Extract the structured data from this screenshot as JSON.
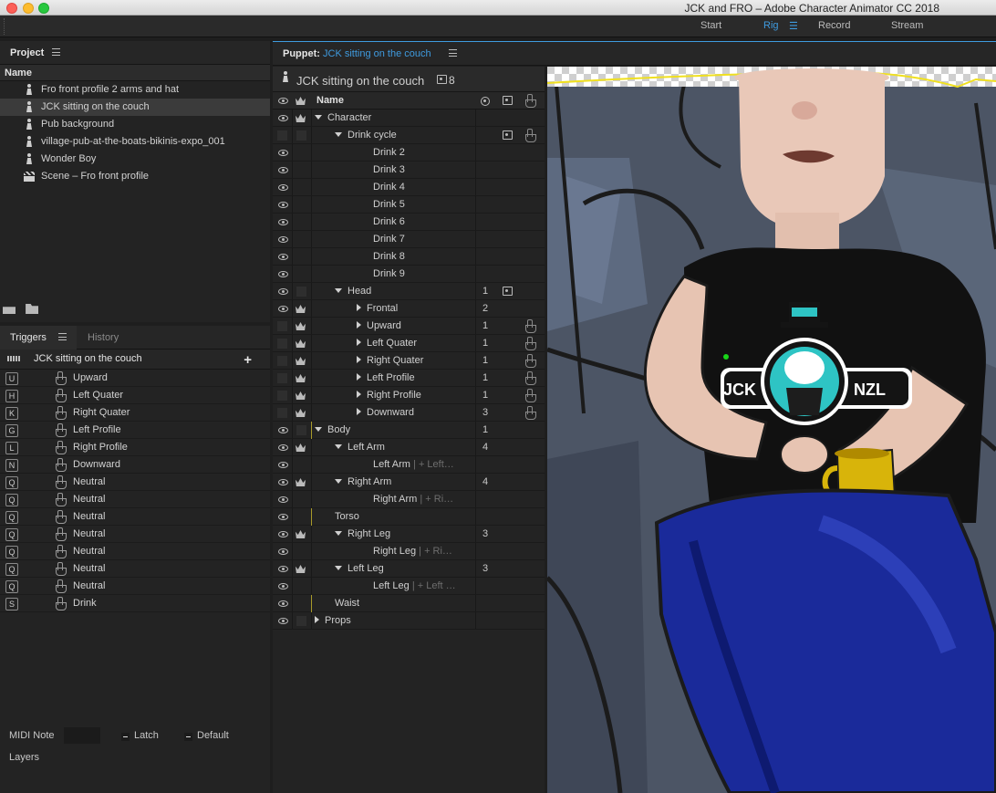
{
  "window": {
    "title": "JCK and FRO – Adobe Character Animator CC 2018"
  },
  "workspaces": [
    {
      "label": "Start",
      "active": false
    },
    {
      "label": "Rig",
      "active": true
    },
    {
      "label": "Record",
      "active": false
    },
    {
      "label": "Stream",
      "active": false
    }
  ],
  "project": {
    "title": "Project",
    "column_name": "Name",
    "items": [
      {
        "label": "Fro front profile 2 arms and hat",
        "icon": "puppet-icon"
      },
      {
        "label": "JCK sitting on the couch",
        "icon": "puppet-icon",
        "selected": true
      },
      {
        "label": "Pub background",
        "icon": "puppet-icon"
      },
      {
        "label": "village-pub-at-the-boats-bikinis-expo_001",
        "icon": "puppet-icon"
      },
      {
        "label": "Wonder Boy",
        "icon": "puppet-icon"
      },
      {
        "label": "Scene – Fro front profile",
        "icon": "scene-icon"
      }
    ]
  },
  "triggers": {
    "tab_triggers": "Triggers",
    "tab_history": "History",
    "puppet_name": "JCK sitting on the couch",
    "rows": [
      {
        "key": "U",
        "label": "Upward"
      },
      {
        "key": "H",
        "label": "Left Quater"
      },
      {
        "key": "K",
        "label": "Right Quater"
      },
      {
        "key": "G",
        "label": "Left Profile"
      },
      {
        "key": "L",
        "label": "Right  Profile"
      },
      {
        "key": "N",
        "label": "Downward"
      },
      {
        "key": "Q",
        "label": "Neutral"
      },
      {
        "key": "Q",
        "label": "Neutral"
      },
      {
        "key": "Q",
        "label": "Neutral"
      },
      {
        "key": "Q",
        "label": "Neutral"
      },
      {
        "key": "Q",
        "label": "Neutral"
      },
      {
        "key": "Q",
        "label": "Neutral"
      },
      {
        "key": "Q",
        "label": "Neutral"
      },
      {
        "key": "S",
        "label": "Drink"
      }
    ],
    "midi_note_label": "MIDI Note",
    "latch_label": "Latch",
    "default_label": "Default",
    "layers_label": "Layers"
  },
  "puppet": {
    "panel_label": "Puppet:",
    "panel_name": "JCK sitting on the couch",
    "header_name": "JCK sitting on the couch",
    "header_count": "8",
    "column_name": "Name",
    "rows": [
      {
        "name": "Character",
        "indent": 0,
        "arrow": "down",
        "eye": true,
        "crown": true,
        "num": "",
        "cam": false,
        "hand": false
      },
      {
        "name": "Drink cycle",
        "indent": 1,
        "arrow": "down",
        "eye": false,
        "crown": false,
        "num": "",
        "cam": true,
        "hand": true
      },
      {
        "name": "Drink 2",
        "indent": 2,
        "arrow": "",
        "eye": true,
        "crown": false,
        "num": ""
      },
      {
        "name": "Drink 3",
        "indent": 2,
        "arrow": "",
        "eye": true,
        "crown": false,
        "num": ""
      },
      {
        "name": "Drink 4",
        "indent": 2,
        "arrow": "",
        "eye": true,
        "crown": false,
        "num": ""
      },
      {
        "name": "Drink 5",
        "indent": 2,
        "arrow": "",
        "eye": true,
        "crown": false,
        "num": ""
      },
      {
        "name": "Drink 6",
        "indent": 2,
        "arrow": "",
        "eye": true,
        "crown": false,
        "num": ""
      },
      {
        "name": "Drink 7",
        "indent": 2,
        "arrow": "",
        "eye": true,
        "crown": false,
        "num": ""
      },
      {
        "name": "Drink 8",
        "indent": 2,
        "arrow": "",
        "eye": true,
        "crown": false,
        "num": ""
      },
      {
        "name": "Drink 9",
        "indent": 2,
        "arrow": "",
        "eye": true,
        "crown": false,
        "num": ""
      },
      {
        "name": "Head",
        "indent": 1,
        "arrow": "down",
        "eye": true,
        "crown": false,
        "num": "1",
        "cam": true
      },
      {
        "name": "Frontal",
        "indent": 2,
        "arrow": "right",
        "eye": true,
        "crown": true,
        "num": "2"
      },
      {
        "name": "Upward",
        "indent": 2,
        "arrow": "right",
        "eye": false,
        "crown": true,
        "num": "1",
        "hand": true
      },
      {
        "name": "Left Quater",
        "indent": 2,
        "arrow": "right",
        "eye": false,
        "crown": true,
        "num": "1",
        "hand": true
      },
      {
        "name": "Right Quater",
        "indent": 2,
        "arrow": "right",
        "eye": false,
        "crown": true,
        "num": "1",
        "hand": true
      },
      {
        "name": "Left Profile",
        "indent": 2,
        "arrow": "right",
        "eye": false,
        "crown": true,
        "num": "1",
        "hand": true
      },
      {
        "name": "Right  Profile",
        "indent": 2,
        "arrow": "right",
        "eye": false,
        "crown": true,
        "num": "1",
        "hand": true
      },
      {
        "name": "Downward",
        "indent": 2,
        "arrow": "right",
        "eye": false,
        "crown": true,
        "num": "3",
        "hand": true
      },
      {
        "name": "Body",
        "indent": 0,
        "arrow": "down",
        "eye": true,
        "crown": false,
        "num": "1",
        "guide": true
      },
      {
        "name": "Left Arm",
        "indent": 1,
        "arrow": "down",
        "eye": true,
        "crown": true,
        "num": "4"
      },
      {
        "name": "Left Arm",
        "indent": 2,
        "arrow": "",
        "eye": true,
        "crown": false,
        "num": "",
        "hint": " | + Left…"
      },
      {
        "name": "Right Arm",
        "indent": 1,
        "arrow": "down",
        "eye": true,
        "crown": true,
        "num": "4"
      },
      {
        "name": "Right Arm",
        "indent": 2,
        "arrow": "",
        "eye": true,
        "crown": false,
        "num": "",
        "hint": " | + Ri…"
      },
      {
        "name": "Torso",
        "indent": 1,
        "arrow": "",
        "eye": true,
        "crown": false,
        "num": "",
        "guide": true
      },
      {
        "name": "Right Leg",
        "indent": 1,
        "arrow": "down",
        "eye": true,
        "crown": true,
        "num": "3"
      },
      {
        "name": "Right Leg",
        "indent": 2,
        "arrow": "",
        "eye": true,
        "crown": false,
        "num": "",
        "hint": " | + Ri…"
      },
      {
        "name": "Left Leg",
        "indent": 1,
        "arrow": "down",
        "eye": true,
        "crown": true,
        "num": "3"
      },
      {
        "name": "Left Leg",
        "indent": 2,
        "arrow": "",
        "eye": true,
        "crown": false,
        "num": "",
        "hint": " | + Left …"
      },
      {
        "name": "Waist",
        "indent": 1,
        "arrow": "",
        "eye": true,
        "crown": false,
        "num": "",
        "guide": true
      },
      {
        "name": "Props",
        "indent": 0,
        "arrow": "right",
        "eye": true,
        "crown": false,
        "num": ""
      }
    ]
  },
  "canvas": {
    "shirt_left": "JCK",
    "shirt_right": "NZL"
  },
  "colors": {
    "accent": "#3f9bdf",
    "panel_bg": "#232323",
    "mug": "#d8b40a",
    "jeans": "#1a2a9a"
  }
}
